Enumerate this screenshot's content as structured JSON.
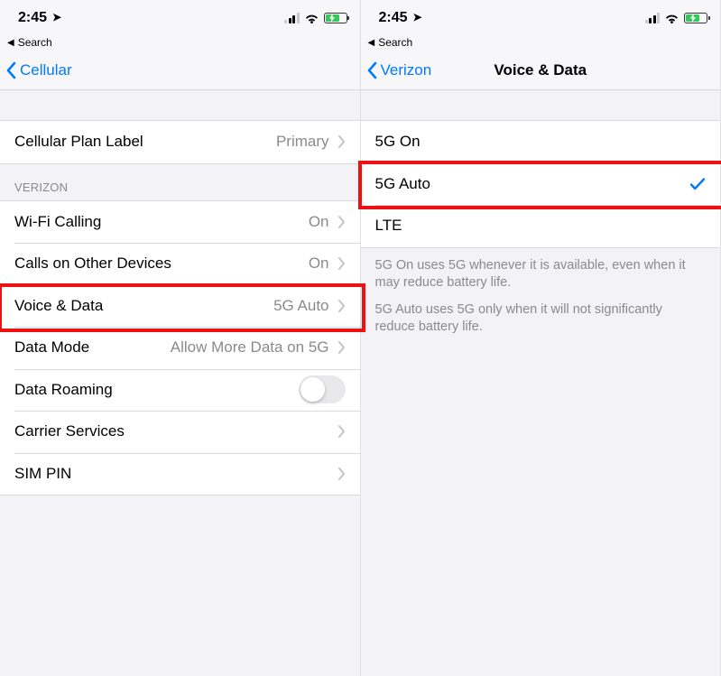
{
  "left": {
    "status": {
      "time": "2:45",
      "breadcrumb": "Search"
    },
    "nav": {
      "back": "Cellular",
      "title": ""
    },
    "rows": {
      "plan_label": "Cellular Plan Label",
      "plan_value": "Primary",
      "group_verizon": "VERIZON",
      "wifi_calling": "Wi-Fi Calling",
      "wifi_calling_value": "On",
      "calls_other": "Calls on Other Devices",
      "calls_other_value": "On",
      "voice_data": "Voice & Data",
      "voice_data_value": "5G Auto",
      "data_mode": "Data Mode",
      "data_mode_value": "Allow More Data on 5G",
      "data_roaming": "Data Roaming",
      "carrier_services": "Carrier Services",
      "sim_pin": "SIM PIN"
    }
  },
  "right": {
    "status": {
      "time": "2:45",
      "breadcrumb": "Search"
    },
    "nav": {
      "back": "Verizon",
      "title": "Voice & Data"
    },
    "options": {
      "opt_5g_on": "5G On",
      "opt_5g_auto": "5G Auto",
      "opt_lte": "LTE"
    },
    "notes": {
      "note1": "5G On uses 5G whenever it is available, even when it may reduce battery life.",
      "note2": "5G Auto uses 5G only when it will not significantly reduce battery life."
    }
  }
}
